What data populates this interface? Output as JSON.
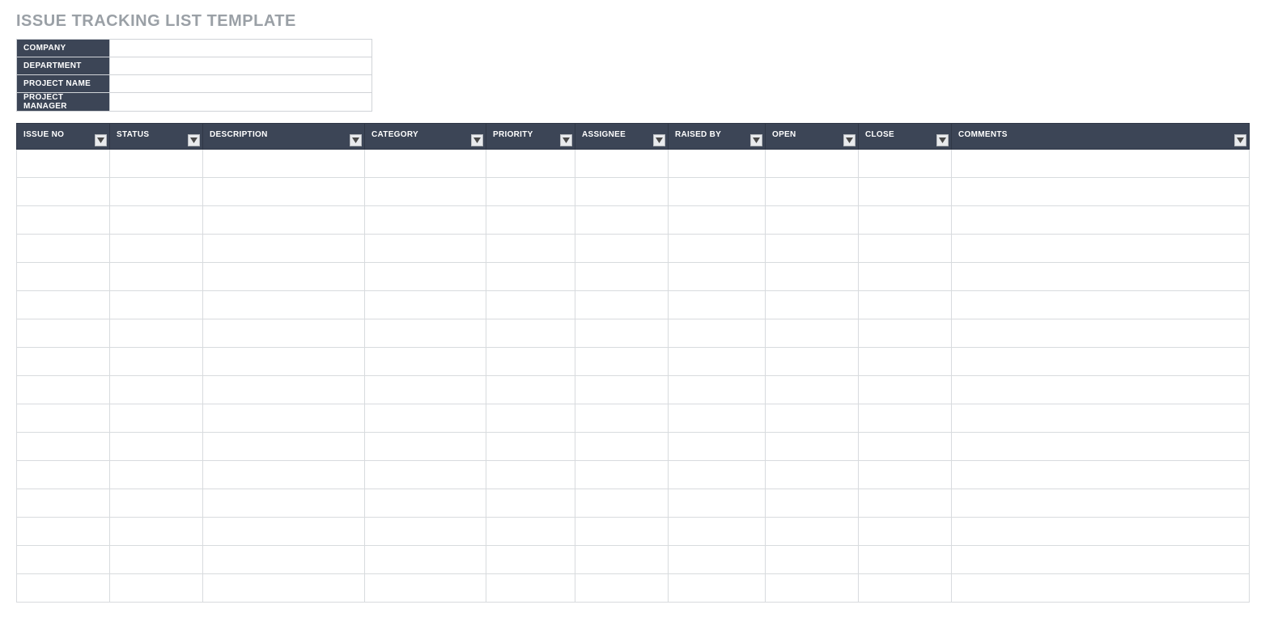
{
  "title": "ISSUE TRACKING LIST TEMPLATE",
  "meta": {
    "fields": [
      {
        "label": "COMPANY",
        "value": ""
      },
      {
        "label": "DEPARTMENT",
        "value": ""
      },
      {
        "label": "PROJECT NAME",
        "value": ""
      },
      {
        "label": "PROJECT MANAGER",
        "value": ""
      }
    ]
  },
  "columns": [
    {
      "key": "issue_no",
      "label": "ISSUE NO"
    },
    {
      "key": "status",
      "label": "STATUS"
    },
    {
      "key": "description",
      "label": "DESCRIPTION"
    },
    {
      "key": "category",
      "label": "CATEGORY"
    },
    {
      "key": "priority",
      "label": "PRIORITY"
    },
    {
      "key": "assignee",
      "label": "ASSIGNEE"
    },
    {
      "key": "raised_by",
      "label": "RAISED BY"
    },
    {
      "key": "open",
      "label": "OPEN"
    },
    {
      "key": "close",
      "label": "CLOSE"
    },
    {
      "key": "comments",
      "label": "COMMENTS"
    }
  ],
  "rows": [
    {
      "issue_no": "",
      "status": "",
      "description": "",
      "category": "",
      "priority": "",
      "assignee": "",
      "raised_by": "",
      "open": "",
      "close": "",
      "comments": ""
    },
    {
      "issue_no": "",
      "status": "",
      "description": "",
      "category": "",
      "priority": "",
      "assignee": "",
      "raised_by": "",
      "open": "",
      "close": "",
      "comments": ""
    },
    {
      "issue_no": "",
      "status": "",
      "description": "",
      "category": "",
      "priority": "",
      "assignee": "",
      "raised_by": "",
      "open": "",
      "close": "",
      "comments": ""
    },
    {
      "issue_no": "",
      "status": "",
      "description": "",
      "category": "",
      "priority": "",
      "assignee": "",
      "raised_by": "",
      "open": "",
      "close": "",
      "comments": ""
    },
    {
      "issue_no": "",
      "status": "",
      "description": "",
      "category": "",
      "priority": "",
      "assignee": "",
      "raised_by": "",
      "open": "",
      "close": "",
      "comments": ""
    },
    {
      "issue_no": "",
      "status": "",
      "description": "",
      "category": "",
      "priority": "",
      "assignee": "",
      "raised_by": "",
      "open": "",
      "close": "",
      "comments": ""
    },
    {
      "issue_no": "",
      "status": "",
      "description": "",
      "category": "",
      "priority": "",
      "assignee": "",
      "raised_by": "",
      "open": "",
      "close": "",
      "comments": ""
    },
    {
      "issue_no": "",
      "status": "",
      "description": "",
      "category": "",
      "priority": "",
      "assignee": "",
      "raised_by": "",
      "open": "",
      "close": "",
      "comments": ""
    },
    {
      "issue_no": "",
      "status": "",
      "description": "",
      "category": "",
      "priority": "",
      "assignee": "",
      "raised_by": "",
      "open": "",
      "close": "",
      "comments": ""
    },
    {
      "issue_no": "",
      "status": "",
      "description": "",
      "category": "",
      "priority": "",
      "assignee": "",
      "raised_by": "",
      "open": "",
      "close": "",
      "comments": ""
    },
    {
      "issue_no": "",
      "status": "",
      "description": "",
      "category": "",
      "priority": "",
      "assignee": "",
      "raised_by": "",
      "open": "",
      "close": "",
      "comments": ""
    },
    {
      "issue_no": "",
      "status": "",
      "description": "",
      "category": "",
      "priority": "",
      "assignee": "",
      "raised_by": "",
      "open": "",
      "close": "",
      "comments": ""
    },
    {
      "issue_no": "",
      "status": "",
      "description": "",
      "category": "",
      "priority": "",
      "assignee": "",
      "raised_by": "",
      "open": "",
      "close": "",
      "comments": ""
    },
    {
      "issue_no": "",
      "status": "",
      "description": "",
      "category": "",
      "priority": "",
      "assignee": "",
      "raised_by": "",
      "open": "",
      "close": "",
      "comments": ""
    },
    {
      "issue_no": "",
      "status": "",
      "description": "",
      "category": "",
      "priority": "",
      "assignee": "",
      "raised_by": "",
      "open": "",
      "close": "",
      "comments": ""
    },
    {
      "issue_no": "",
      "status": "",
      "description": "",
      "category": "",
      "priority": "",
      "assignee": "",
      "raised_by": "",
      "open": "",
      "close": "",
      "comments": ""
    }
  ]
}
